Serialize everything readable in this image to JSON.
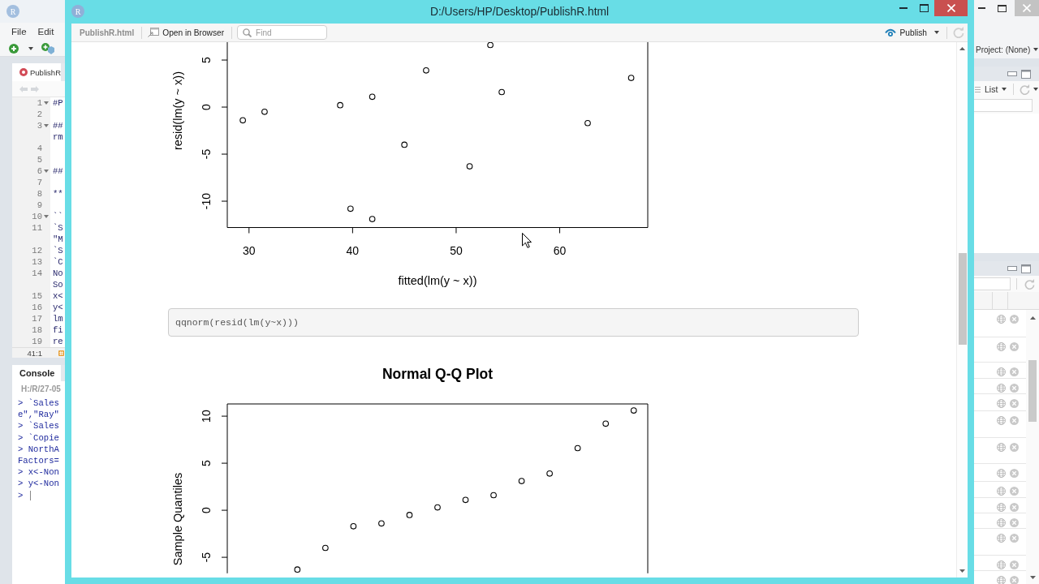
{
  "background_window": {
    "logo": "R",
    "menu": [
      "File",
      "Edit"
    ],
    "editor_tab": "PublishR",
    "editor_lines": [
      {
        "number": "1",
        "fold": true,
        "text": "#P"
      },
      {
        "number": "2",
        "fold": false
      },
      {
        "number": "3",
        "fold": true,
        "text": "##",
        "wrapped_text": "rm"
      },
      {
        "number": "4",
        "fold": false
      },
      {
        "number": "5",
        "fold": false
      },
      {
        "number": "6",
        "fold": true,
        "text": "##"
      },
      {
        "number": "7",
        "fold": false
      },
      {
        "number": "8",
        "fold": false,
        "text": "**"
      },
      {
        "number": "9",
        "fold": false
      },
      {
        "number": "10",
        "fold": true,
        "text": "``"
      },
      {
        "number": "11",
        "fold": false,
        "text": "`S",
        "wrapped_text": "\"M"
      },
      {
        "number": "12",
        "fold": false,
        "text": "`S"
      },
      {
        "number": "13",
        "fold": false,
        "text": "`C"
      },
      {
        "number": "14",
        "fold": false,
        "text": "No",
        "wrapped_text": "So"
      },
      {
        "number": "15",
        "fold": false,
        "text": "x<"
      },
      {
        "number": "16",
        "fold": false,
        "text": "y<"
      },
      {
        "number": "17",
        "fold": false,
        "text": "lm"
      },
      {
        "number": "18",
        "fold": false,
        "text": "fi"
      },
      {
        "number": "19",
        "fold": false,
        "text": "re"
      }
    ],
    "cursor_position": "41:1",
    "console": {
      "tab": "Console",
      "path": "H:/R/27-05",
      "lines": [
        "> `Sales",
        "e\",\"Ray\"",
        "> `Sales",
        "> `Copie",
        "> NorthA",
        "Factors=",
        "> x<-Non",
        "> y<-Non",
        ">"
      ]
    },
    "project_menu": "Project: (None)",
    "environment_view": "List"
  },
  "window": {
    "logo": "R",
    "title": "D:/Users/HP/Desktop/PublishR.html"
  },
  "toolbar": {
    "file_name": "PublishR.html",
    "open_button": "Open in Browser",
    "find": {
      "placeholder": "Find"
    },
    "publish_button": "Publish"
  },
  "document": {
    "blocks": [
      {
        "kind": "plot",
        "chart_data": {
          "type": "scatter",
          "xlabel": "fitted(lm(y ~ x))",
          "ylabel": "resid(lm(y ~ x))",
          "x": [
            29.4,
            31.5,
            38.8,
            39.8,
            41.9,
            41.9,
            45.0,
            47.1,
            51.3,
            53.3,
            54.4,
            62.7,
            66.9
          ],
          "values": [
            -1.4,
            -0.5,
            0.2,
            -10.8,
            1.1,
            -11.9,
            -4.0,
            3.9,
            -6.3,
            6.6,
            1.6,
            -1.7,
            3.1
          ],
          "xlim": [
            27.9,
            68.5
          ],
          "ylim": [
            -12.8,
            6.9
          ],
          "xticks": [
            30,
            40,
            50,
            60
          ],
          "yticks": [
            -10,
            -5,
            0,
            5
          ],
          "marker": "circle"
        }
      },
      {
        "kind": "code",
        "code": "qqnorm(resid(lm(y~x)))"
      },
      {
        "kind": "plot",
        "chart_data": {
          "type": "scatter",
          "title": "Normal Q-Q Plot",
          "ylabel": "Sample Quantiles",
          "categories": [
            null,
            null,
            null,
            null,
            null,
            null,
            null,
            null,
            null,
            null,
            null,
            null,
            null,
            null,
            null
          ],
          "values": [
            null,
            null,
            -6.3,
            -4.0,
            -1.7,
            -1.4,
            -0.5,
            0.3,
            1.1,
            1.6,
            3.1,
            3.9,
            6.6,
            9.2,
            10.6
          ],
          "ylim": [
            -6.7,
            11.3
          ],
          "yticks": [
            -5,
            0,
            5,
            10
          ],
          "marker": "circle"
        }
      }
    ]
  }
}
